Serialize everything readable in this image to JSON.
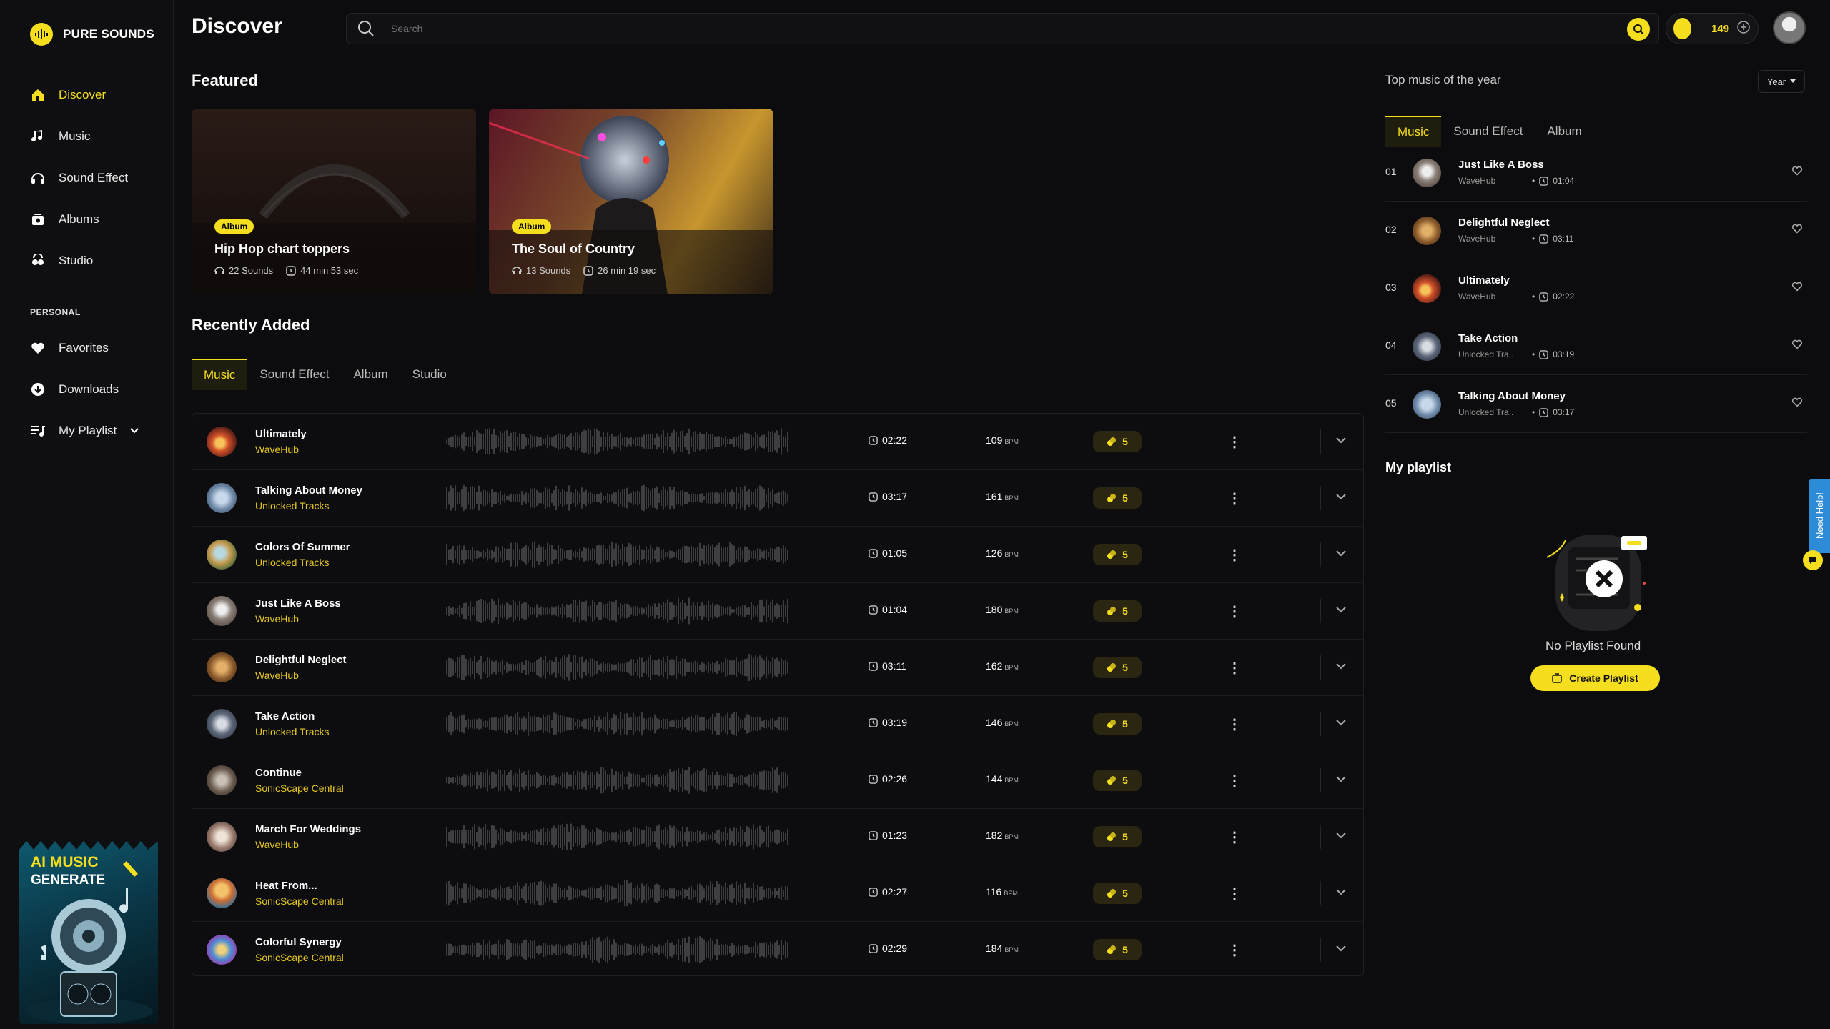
{
  "brand": {
    "name": "PURE SOUNDS",
    "accent": "#f5de1e"
  },
  "nav": {
    "items": [
      {
        "label": "Discover",
        "icon": "home-icon",
        "active": true
      },
      {
        "label": "Music",
        "icon": "music-note-icon"
      },
      {
        "label": "Sound Effect",
        "icon": "headphones-icon"
      },
      {
        "label": "Albums",
        "icon": "album-icon"
      },
      {
        "label": "Studio",
        "icon": "studio-icon"
      }
    ],
    "personal_label": "PERSONAL",
    "personal": [
      {
        "label": "Favorites",
        "icon": "heart-icon"
      },
      {
        "label": "Downloads",
        "icon": "download-icon"
      },
      {
        "label": "My Playlist",
        "icon": "playlist-icon"
      }
    ]
  },
  "promo": {
    "line1": "AI MUSIC",
    "line2": "GENERATE"
  },
  "header": {
    "title": "Discover",
    "search_placeholder": "Search",
    "credits": "149"
  },
  "featured": {
    "title": "Featured",
    "cards": [
      {
        "badge": "Album",
        "title": "Hip Hop chart toppers",
        "sounds": "22 Sounds",
        "duration": "44 min 53 sec"
      },
      {
        "badge": "Album",
        "title": "The Soul of Country",
        "sounds": "13 Sounds",
        "duration": "26 min 19 sec"
      }
    ]
  },
  "recent": {
    "title": "Recently Added",
    "tabs": [
      "Music",
      "Sound Effect",
      "Album",
      "Studio"
    ],
    "bpm_unit": "BPM",
    "rows": [
      {
        "title": "Ultimately",
        "artist": "WaveHub",
        "duration": "02:22",
        "bpm": "109",
        "credits": "5"
      },
      {
        "title": "Talking About Money",
        "artist": "Unlocked Tracks",
        "duration": "03:17",
        "bpm": "161",
        "credits": "5"
      },
      {
        "title": "Colors Of Summer",
        "artist": "Unlocked Tracks",
        "duration": "01:05",
        "bpm": "126",
        "credits": "5"
      },
      {
        "title": "Just Like A Boss",
        "artist": "WaveHub",
        "duration": "01:04",
        "bpm": "180",
        "credits": "5"
      },
      {
        "title": "Delightful Neglect",
        "artist": "WaveHub",
        "duration": "03:11",
        "bpm": "162",
        "credits": "5"
      },
      {
        "title": "Take Action",
        "artist": "Unlocked Tracks",
        "duration": "03:19",
        "bpm": "146",
        "credits": "5"
      },
      {
        "title": "Continue",
        "artist": "SonicScape Central",
        "duration": "02:26",
        "bpm": "144",
        "credits": "5"
      },
      {
        "title": "March For Weddings",
        "artist": "WaveHub",
        "duration": "01:23",
        "bpm": "182",
        "credits": "5"
      },
      {
        "title": "Heat From...",
        "artist": "SonicScape Central",
        "duration": "02:27",
        "bpm": "116",
        "credits": "5"
      },
      {
        "title": "Colorful Synergy",
        "artist": "SonicScape Central",
        "duration": "02:29",
        "bpm": "184",
        "credits": "5"
      }
    ]
  },
  "top": {
    "title": "Top music of the year",
    "filter": "Year",
    "tabs": [
      "Music",
      "Sound Effect",
      "Album"
    ],
    "rows": [
      {
        "no": "01",
        "title": "Just Like A Boss",
        "artist": "WaveHub",
        "duration": "01:04"
      },
      {
        "no": "02",
        "title": "Delightful Neglect",
        "artist": "WaveHub",
        "duration": "03:11"
      },
      {
        "no": "03",
        "title": "Ultimately",
        "artist": "WaveHub",
        "duration": "02:22"
      },
      {
        "no": "04",
        "title": "Take Action",
        "artist": "Unlocked Tra..",
        "duration": "03:19"
      },
      {
        "no": "05",
        "title": "Talking About Money",
        "artist": "Unlocked Tra..",
        "duration": "03:17"
      }
    ]
  },
  "playlist": {
    "title": "My playlist",
    "empty_text": "No Playlist Found",
    "create_label": "Create Playlist"
  },
  "help": {
    "label": "Need Help!"
  }
}
